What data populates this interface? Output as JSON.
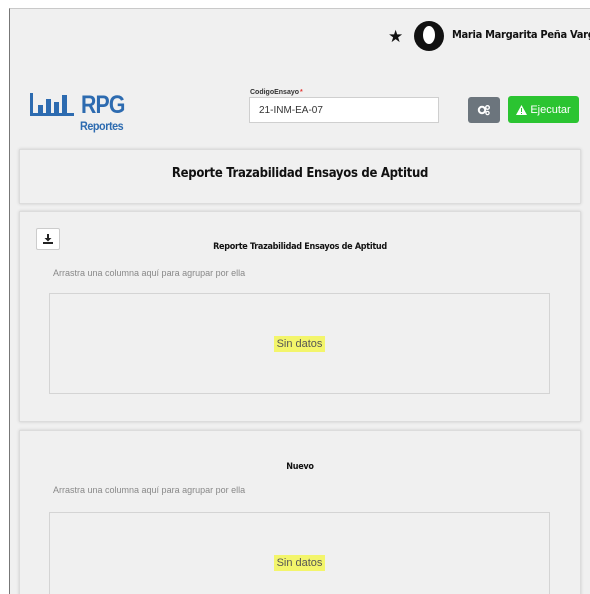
{
  "header": {
    "user_name": "Maria Margarita Peña Vargas",
    "favorite_icon": "star-icon",
    "avatar_icon": "user-avatar-icon"
  },
  "logo": {
    "title": "RPG",
    "subtitle": "Reportes",
    "icon": "bar-chart-icon"
  },
  "form": {
    "field_label": "CodigoEnsayo",
    "field_required_mark": "*",
    "field_value": "21-INM-EA-07"
  },
  "toolbar": {
    "settings_icon": "gears-icon",
    "run_label": "Ejecutar",
    "run_icon": "warning-icon"
  },
  "report": {
    "title": "Reporte Trazabilidad Ensayos de Aptitud"
  },
  "grids": [
    {
      "title": "Reporte Trazabilidad Ensayos de Aptitud",
      "group_hint": "Arrastra una columna aquí para agrupar por ella",
      "empty_text": "Sin datos",
      "export_icon": "download-icon"
    },
    {
      "title": "Nuevo",
      "group_hint": "Arrastra una columna aquí para agrupar por ella",
      "empty_text": "Sin datos"
    }
  ],
  "colors": {
    "brand": "#2d6bb0",
    "run_button": "#2bc431",
    "settings_button": "#6c757d",
    "highlight": "#f3f56b"
  }
}
